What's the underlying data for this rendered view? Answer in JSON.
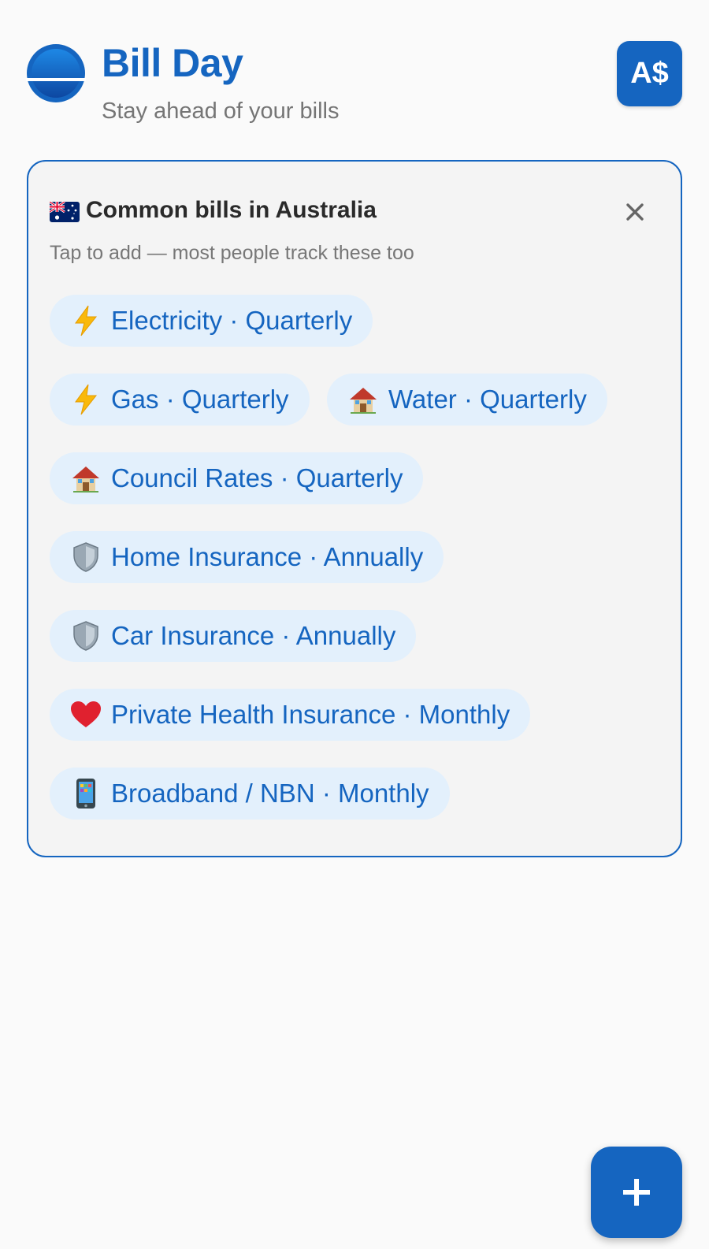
{
  "header": {
    "title": "Bill Day",
    "subtitle": "Stay ahead of your bills",
    "currency_label": "A$",
    "logo_icon": "sunrise-logo-icon"
  },
  "suggestions": {
    "title": "Common bills in Australia",
    "flag_icon": "australia-flag-icon",
    "subtitle": "Tap to add — most people track these too",
    "close_icon": "close-icon",
    "chips": [
      {
        "icon": "lightning-icon",
        "label": "Electricity · Quarterly"
      },
      {
        "icon": "lightning-icon",
        "label": "Gas · Quarterly"
      },
      {
        "icon": "house-icon",
        "label": "Water · Quarterly"
      },
      {
        "icon": "house-icon",
        "label": "Council Rates · Quarterly"
      },
      {
        "icon": "shield-icon",
        "label": "Home Insurance · Annually"
      },
      {
        "icon": "shield-icon",
        "label": "Car Insurance · Annually"
      },
      {
        "icon": "heart-icon",
        "label": "Private Health Insurance · Monthly"
      },
      {
        "icon": "phone-icon",
        "label": "Broadband / NBN · Monthly"
      }
    ]
  },
  "fab": {
    "label": "+",
    "icon": "plus-icon"
  },
  "colors": {
    "primary": "#1565c0",
    "chip_background": "#e3f0fc",
    "card_background": "#f4f4f4",
    "page_background": "#fafafa"
  }
}
